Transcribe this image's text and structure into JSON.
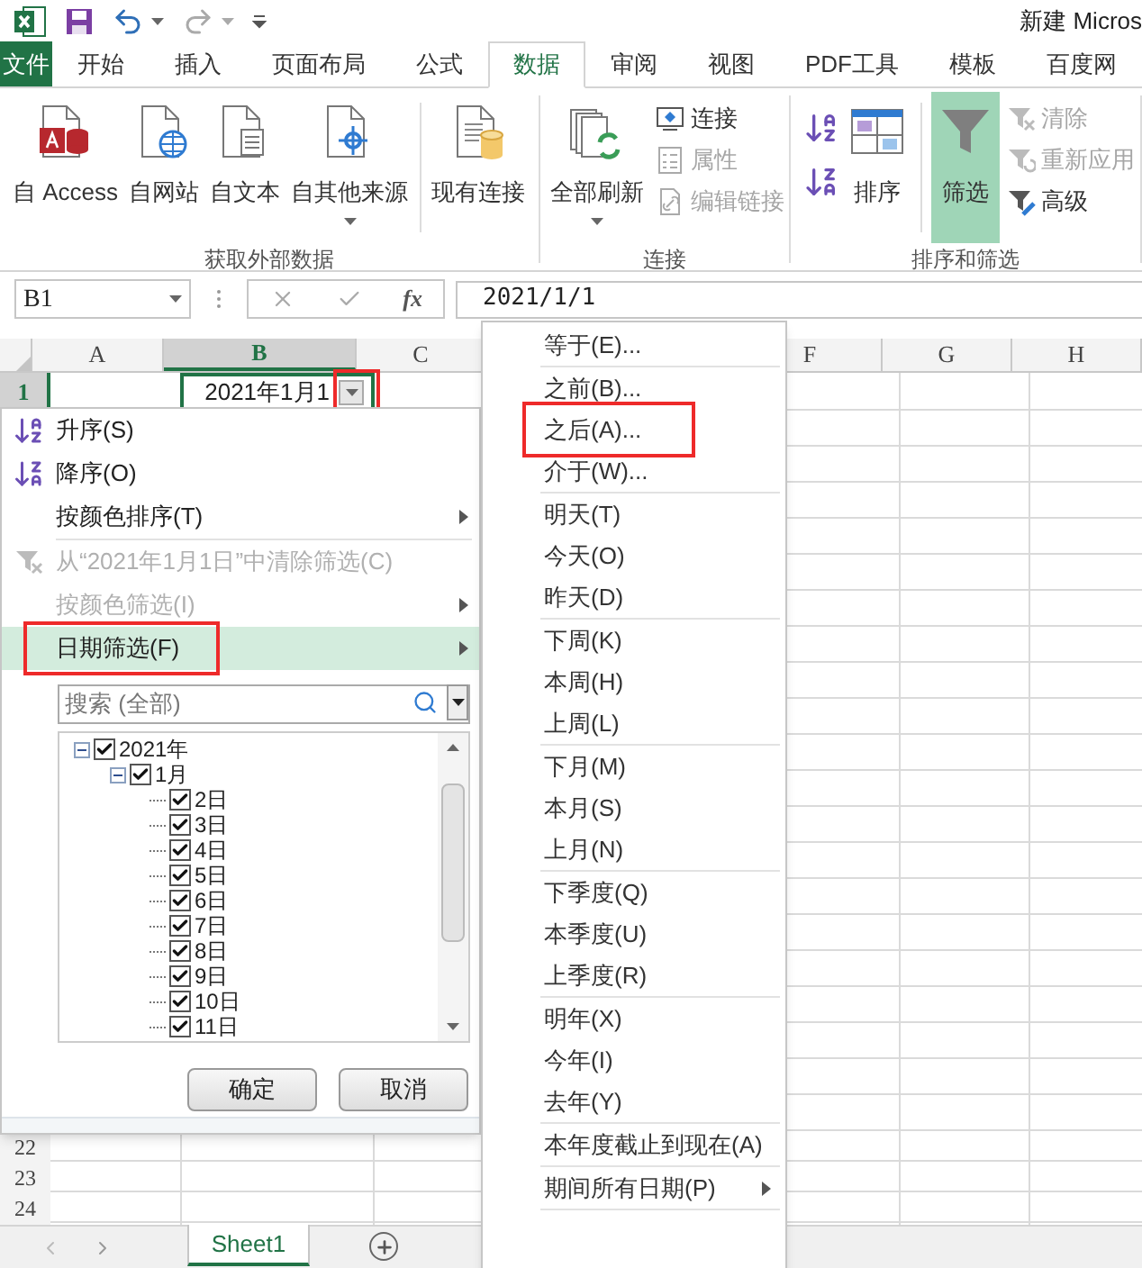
{
  "title_bar": {
    "title": "新建 Micros"
  },
  "ribbon_tabs": [
    {
      "label": "文件",
      "kind": "file",
      "selected": false
    },
    {
      "label": "开始",
      "kind": "tab",
      "selected": false
    },
    {
      "label": "插入",
      "kind": "tab",
      "selected": false
    },
    {
      "label": "页面布局",
      "kind": "tab",
      "selected": false
    },
    {
      "label": "公式",
      "kind": "tab",
      "selected": false
    },
    {
      "label": "数据",
      "kind": "tab",
      "selected": true
    },
    {
      "label": "审阅",
      "kind": "tab",
      "selected": false
    },
    {
      "label": "视图",
      "kind": "tab",
      "selected": false
    },
    {
      "label": "PDF工具",
      "kind": "tab",
      "selected": false
    },
    {
      "label": "模板",
      "kind": "tab",
      "selected": false
    },
    {
      "label": "百度网",
      "kind": "tab",
      "selected": false
    }
  ],
  "ribbon_groups": [
    {
      "label": "获取外部数据",
      "large": [
        {
          "label": "自 Access",
          "caret": false
        },
        {
          "label": "自网站",
          "caret": false
        },
        {
          "label": "自文本",
          "caret": false
        },
        {
          "label": "自其他来源",
          "caret": true
        },
        {
          "label": "现有连接",
          "caret": false
        }
      ]
    },
    {
      "label": "连接",
      "large": [
        {
          "label": "全部刷新",
          "caret": true
        }
      ],
      "small": [
        {
          "label": "连接",
          "disabled": false
        },
        {
          "label": "属性",
          "disabled": true
        },
        {
          "label": "编辑链接",
          "disabled": true
        }
      ]
    },
    {
      "label": "排序和筛选",
      "large": [
        {
          "label": "排序",
          "caret": false,
          "selected": false
        },
        {
          "label": "筛选",
          "caret": false,
          "selected": true
        }
      ],
      "small": [
        {
          "label": "清除",
          "disabled": true
        },
        {
          "label": "重新应用",
          "disabled": true
        },
        {
          "label": "高级",
          "disabled": false
        }
      ]
    }
  ],
  "formula_bar": {
    "name_box": "B1",
    "function_label": "fx",
    "formula": "2021/1/1"
  },
  "grid": {
    "columns": [
      {
        "label": "A",
        "selected": false
      },
      {
        "label": "B",
        "selected": true
      },
      {
        "label": "C",
        "selected": false
      },
      {
        "label": "F",
        "selected": false
      },
      {
        "label": "G",
        "selected": false
      },
      {
        "label": "H",
        "selected": false
      }
    ],
    "first_row": {
      "number": "1",
      "selected": true,
      "active_cell": "2021年1月1",
      "filter_button_annotated": true
    },
    "bottom_rows": [
      {
        "number": "22",
        "selected": false
      },
      {
        "number": "23",
        "selected": false
      },
      {
        "number": "24",
        "selected": false
      }
    ]
  },
  "filter_menu": {
    "item_groups": [
      [
        {
          "label": "升序(S)",
          "kind": "sort_asc",
          "disabled": false,
          "submenu": false,
          "highlighted": false,
          "annotated": false
        },
        {
          "label": "降序(O)",
          "kind": "sort_desc",
          "disabled": false,
          "submenu": false,
          "highlighted": false,
          "annotated": false
        },
        {
          "label": "按颜色排序(T)",
          "kind": "plain",
          "disabled": false,
          "submenu": true,
          "highlighted": false,
          "annotated": false
        }
      ],
      [
        {
          "label": "从“2021年1月1日”中清除筛选(C)",
          "kind": "clear",
          "disabled": true,
          "submenu": false,
          "highlighted": false,
          "annotated": false
        },
        {
          "label": "按颜色筛选(I)",
          "kind": "plain",
          "disabled": true,
          "submenu": true,
          "highlighted": false,
          "annotated": false
        },
        {
          "label": "日期筛选(F)",
          "kind": "plain",
          "disabled": false,
          "submenu": true,
          "highlighted": true,
          "annotated": true
        }
      ]
    ],
    "search": {
      "placeholder": "搜索 (全部)"
    },
    "tree": [
      {
        "label": "2021年",
        "checked": true,
        "expanded": true,
        "children": [
          {
            "label": "1月",
            "checked": true,
            "expanded": true,
            "children": [
              {
                "label": "2日",
                "checked": true
              },
              {
                "label": "3日",
                "checked": true
              },
              {
                "label": "4日",
                "checked": true
              },
              {
                "label": "5日",
                "checked": true
              },
              {
                "label": "6日",
                "checked": true
              },
              {
                "label": "7日",
                "checked": true
              },
              {
                "label": "8日",
                "checked": true
              },
              {
                "label": "9日",
                "checked": true
              },
              {
                "label": "10日",
                "checked": true
              },
              {
                "label": "11日",
                "checked": true
              }
            ]
          }
        ]
      }
    ],
    "buttons": [
      "确定",
      "取消"
    ]
  },
  "date_submenu": {
    "item_groups": [
      [
        {
          "label": "等于(E)...",
          "submenu": false,
          "annotated": false
        }
      ],
      [
        {
          "label": "之前(B)...",
          "submenu": false,
          "annotated": false
        },
        {
          "label": "之后(A)...",
          "submenu": false,
          "annotated": true
        },
        {
          "label": "介于(W)...",
          "submenu": false,
          "annotated": false
        }
      ],
      [
        {
          "label": "明天(T)",
          "submenu": false,
          "annotated": false
        },
        {
          "label": "今天(O)",
          "submenu": false,
          "annotated": false
        },
        {
          "label": "昨天(D)",
          "submenu": false,
          "annotated": false
        }
      ],
      [
        {
          "label": "下周(K)",
          "submenu": false,
          "annotated": false
        },
        {
          "label": "本周(H)",
          "submenu": false,
          "annotated": false
        },
        {
          "label": "上周(L)",
          "submenu": false,
          "annotated": false
        }
      ],
      [
        {
          "label": "下月(M)",
          "submenu": false,
          "annotated": false
        },
        {
          "label": "本月(S)",
          "submenu": false,
          "annotated": false
        },
        {
          "label": "上月(N)",
          "submenu": false,
          "annotated": false
        }
      ],
      [
        {
          "label": "下季度(Q)",
          "submenu": false,
          "annotated": false
        },
        {
          "label": "本季度(U)",
          "submenu": false,
          "annotated": false
        },
        {
          "label": "上季度(R)",
          "submenu": false,
          "annotated": false
        }
      ],
      [
        {
          "label": "明年(X)",
          "submenu": false,
          "annotated": false
        },
        {
          "label": "今年(I)",
          "submenu": false,
          "annotated": false
        },
        {
          "label": "去年(Y)",
          "submenu": false,
          "annotated": false
        }
      ],
      [
        {
          "label": "本年度截止到现在(A)",
          "submenu": false,
          "annotated": false
        }
      ],
      [
        {
          "label": "期间所有日期(P)",
          "submenu": true,
          "annotated": false
        }
      ]
    ]
  },
  "sheet_tabs": [
    {
      "label": "Sheet1",
      "selected": true
    }
  ]
}
